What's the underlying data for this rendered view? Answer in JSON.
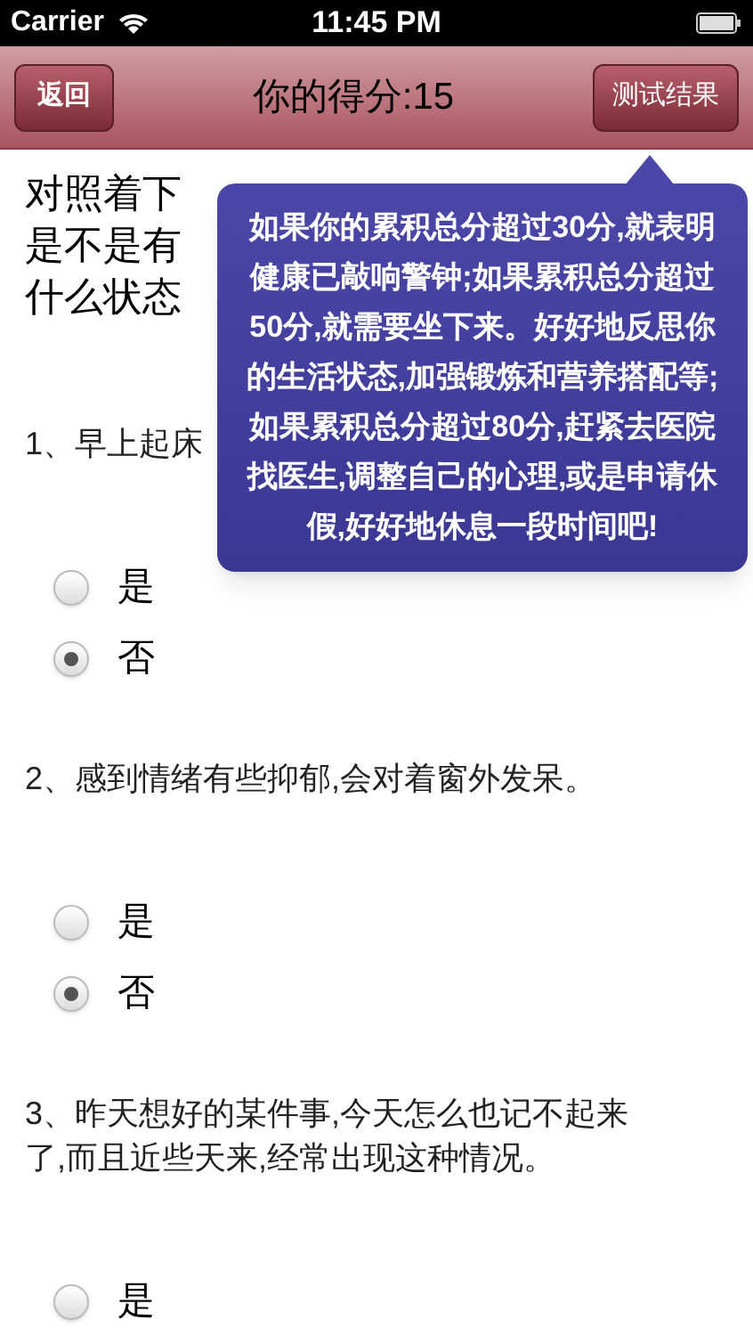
{
  "status_bar": {
    "carrier": "Carrier",
    "time": "11:45 PM"
  },
  "nav_bar": {
    "back_button": "返回",
    "title": "你的得分:15",
    "result_button": "测试结果"
  },
  "intro_lines": [
    "对照着下",
    "是不是有",
    "什么状态"
  ],
  "questions": [
    {
      "text": "1、早上起床",
      "options": [
        {
          "label": "是",
          "selected": false
        },
        {
          "label": "否",
          "selected": true
        }
      ]
    },
    {
      "text": "2、感到情绪有些抑郁,会对着窗外发呆。",
      "options": [
        {
          "label": "是",
          "selected": false
        },
        {
          "label": "否",
          "selected": true
        }
      ]
    },
    {
      "text": "3、昨天想好的某件事,今天怎么也记不起来了,而且近些天来,经常出现这种情况。",
      "options": [
        {
          "label": "是",
          "selected": false
        }
      ]
    }
  ],
  "popover": {
    "text": "如果你的累积总分超过30分,就表明健康已敲响警钟;如果累积总分超过50分,就需要坐下来。好好地反思你的生活状态,加强锻炼和营养搭配等;如果累积总分超过80分,赶紧去医院找医生,调整自己的心理,或是申请休假,好好地休息一段时间吧!"
  }
}
